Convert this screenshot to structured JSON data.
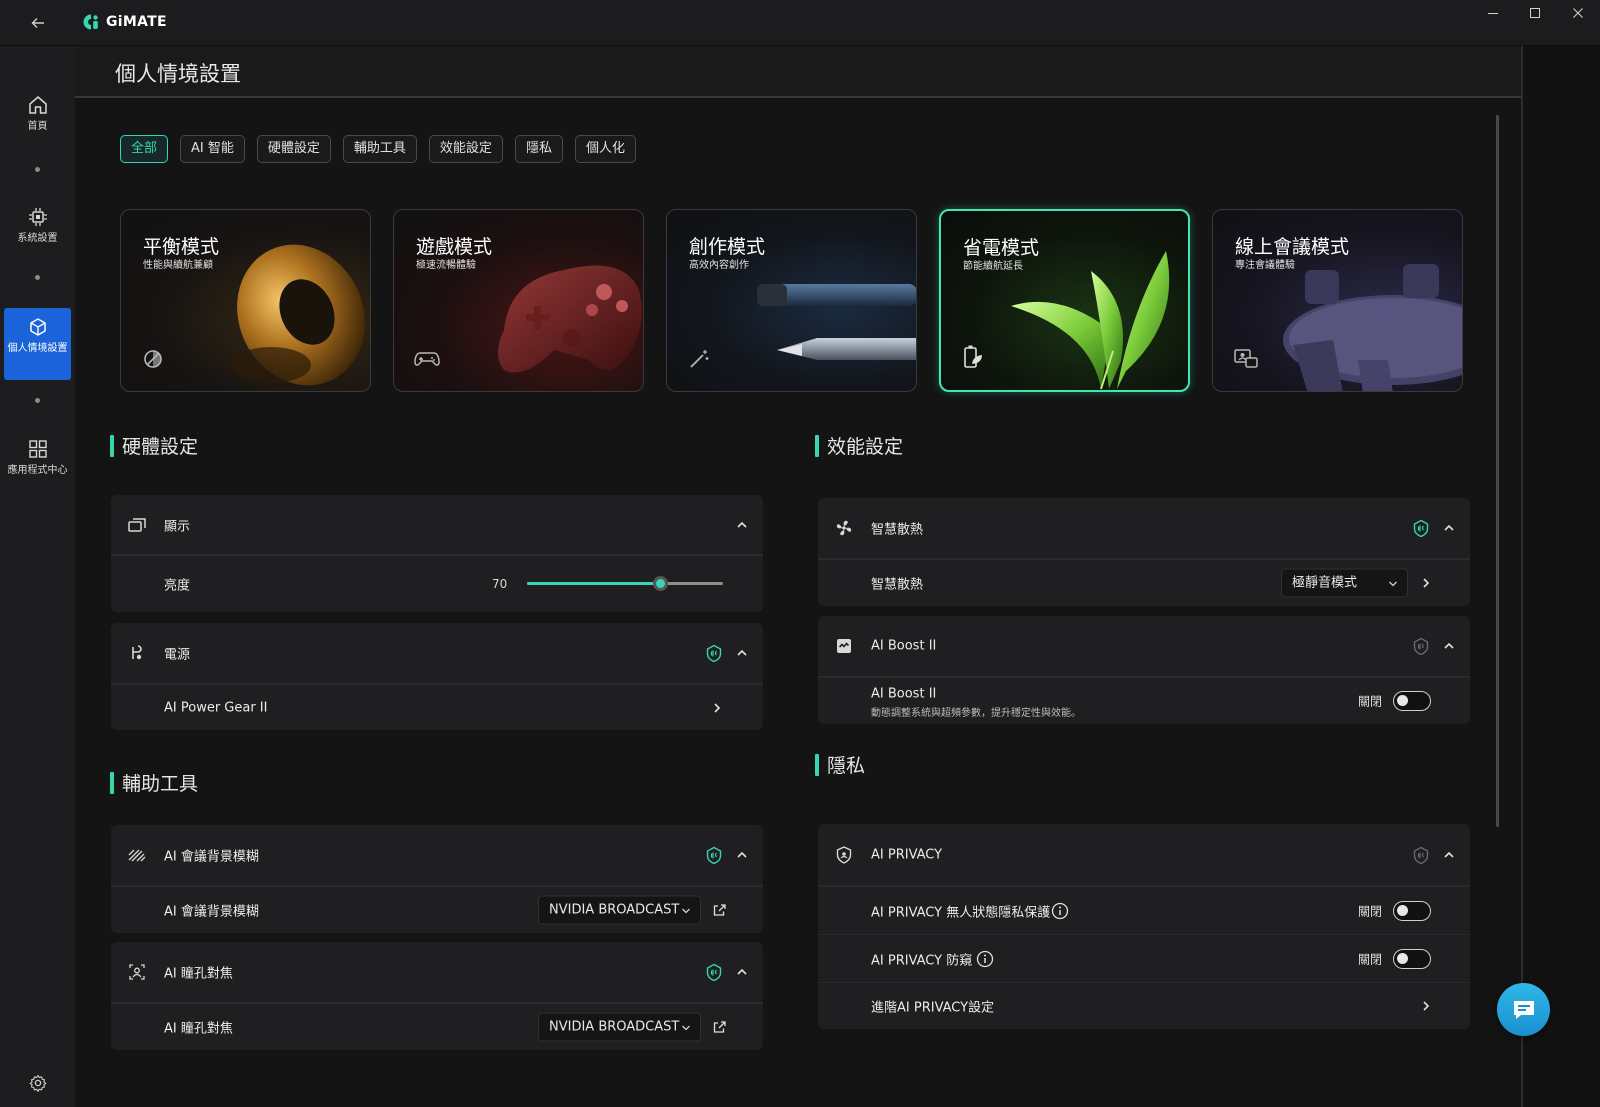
{
  "app": {
    "name": "GiMATE",
    "back_icon": "back-arrow-icon"
  },
  "window_controls": [
    "minimize",
    "maximize",
    "close"
  ],
  "sidebar": {
    "items": [
      {
        "label": "首頁",
        "icon": "home-icon"
      },
      {
        "label": "系統設置",
        "icon": "chip-icon"
      },
      {
        "label": "個人情境設置",
        "icon": "cube-icon",
        "active": true
      },
      {
        "label": "應用程式中心",
        "icon": "apps-grid-icon"
      }
    ],
    "footer_icon": "gear-icon"
  },
  "page": {
    "title": "個人情境設置"
  },
  "tabs": [
    {
      "label": "全部",
      "active": true
    },
    {
      "label": "AI 智能"
    },
    {
      "label": "硬體設定"
    },
    {
      "label": "輔助工具"
    },
    {
      "label": "效能設定"
    },
    {
      "label": "隱私"
    },
    {
      "label": "個人化"
    }
  ],
  "modes": [
    {
      "title": "平衡模式",
      "subtitle": "性能與續航兼顧",
      "icon": "balance-icon"
    },
    {
      "title": "遊戲模式",
      "subtitle": "極速流暢體驗",
      "icon": "gamepad-icon"
    },
    {
      "title": "創作模式",
      "subtitle": "高效內容創作",
      "icon": "magic-wand-icon"
    },
    {
      "title": "省電模式",
      "subtitle": "節能續航延長",
      "icon": "battery-leaf-icon",
      "active": true
    },
    {
      "title": "線上會議模式",
      "subtitle": "專注會議體驗",
      "icon": "meeting-icon"
    }
  ],
  "sections": {
    "hardware": {
      "title": "硬體設定",
      "display": {
        "label": "顯示",
        "brightness_label": "亮度",
        "brightness_value": "70",
        "brightness_level": 0.68
      },
      "power": {
        "label": "電源",
        "item_label": "AI Power Gear II"
      }
    },
    "tools": {
      "title": "輔助工具",
      "blur": {
        "label": "AI 會議背景模糊",
        "item_label": "AI 會議背景模糊",
        "dropdown_value": "NVIDIA BROADCAST"
      },
      "eye": {
        "label": "AI 瞳孔對焦",
        "item_label": "AI 瞳孔對焦",
        "dropdown_value": "NVIDIA BROADCAST"
      }
    },
    "performance": {
      "title": "效能設定",
      "cooling": {
        "label": "智慧散熱",
        "item_label": "智慧散熱",
        "dropdown_value": "極靜音模式"
      },
      "boost": {
        "label": "AI Boost II",
        "item_label": "AI Boost II",
        "item_desc": "動態調整系統與超頻參數，提升穩定性與效能。",
        "toggle_label": "關閉"
      }
    },
    "privacy": {
      "title": "隱私",
      "panel": {
        "label": "AI PRIVACY",
        "items": [
          {
            "label": "AI PRIVACY 無人狀態隱私保護",
            "toggle_label": "關閉"
          },
          {
            "label": "AI PRIVACY 防窺",
            "toggle_label": "關閉"
          },
          {
            "label": "進階AI PRIVACY設定"
          }
        ]
      }
    }
  },
  "colors": {
    "accent": "#35d6b1",
    "sidebar_active": "#1a63d8"
  }
}
